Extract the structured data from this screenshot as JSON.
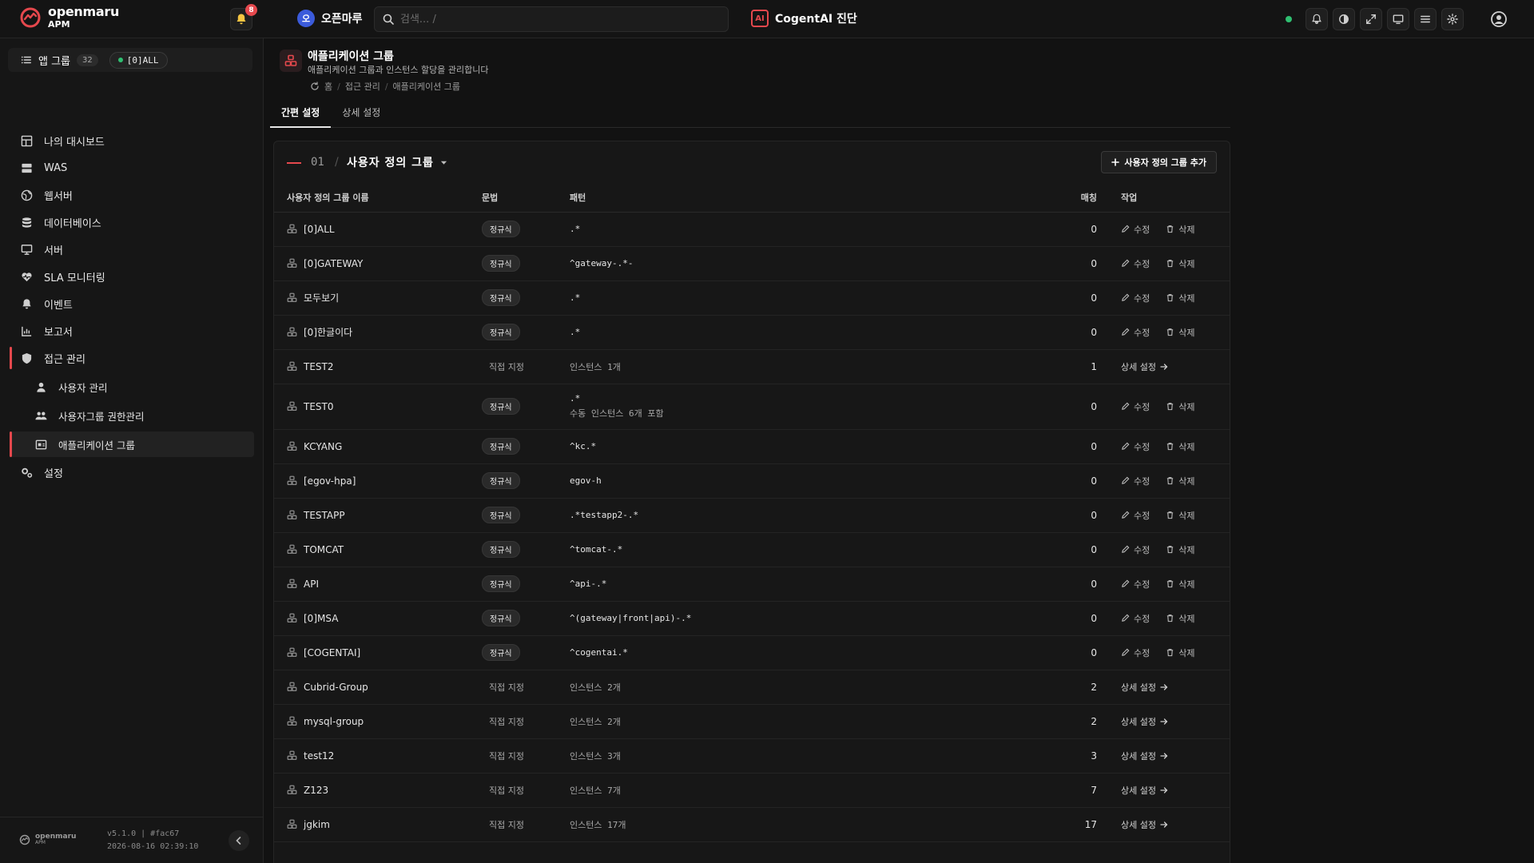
{
  "topbar": {
    "logo_name": "openmaru",
    "logo_sub": "APM",
    "notification_count": "8",
    "org_avatar": "오",
    "org_name": "오픈마루",
    "search_placeholder": "검색... /",
    "ai_mark": "AI",
    "ai_label": "CogentAI 진단",
    "status_color": "#2fbf71",
    "tool_icons": [
      "bell-icon",
      "contrast-icon",
      "expand-icon",
      "monitor-icon",
      "menu-icon",
      "gear-icon"
    ]
  },
  "sidebar": {
    "appgroup_label": "앱 그룹",
    "appgroup_count": "32",
    "selected_group": "[0]ALL",
    "items": [
      {
        "label": "나의 대시보드",
        "icon": "dashboard-icon"
      },
      {
        "label": "WAS",
        "icon": "server-stack-icon"
      },
      {
        "label": "웹서버",
        "icon": "globe-icon"
      },
      {
        "label": "데이터베이스",
        "icon": "database-icon"
      },
      {
        "label": "서버",
        "icon": "monitor-icon"
      },
      {
        "label": "SLA 모니터링",
        "icon": "heart-pulse-icon"
      },
      {
        "label": "이벤트",
        "icon": "bell-icon"
      },
      {
        "label": "보고서",
        "icon": "chart-icon"
      },
      {
        "label": "접근 관리",
        "icon": "shield-icon"
      },
      {
        "label": "사용자 관리",
        "icon": "user-icon"
      },
      {
        "label": "사용자그룹 권한관리",
        "icon": "users-icon"
      },
      {
        "label": "애플리케이션 그룹",
        "icon": "app-group-icon"
      },
      {
        "label": "설정",
        "icon": "gears-icon"
      }
    ],
    "footer_logo": "openmaru",
    "footer_logo_sub": "APM",
    "version": "v5.1.0 | #fac67",
    "build_time": "2026-08-16 02:39:10"
  },
  "page": {
    "title": "애플리케이션 그룹",
    "description": "애플리케이션 그룹과 인스턴스 할당을 관리합니다",
    "breadcrumb": [
      "홈",
      "접근 관리",
      "애플리케이션 그룹"
    ],
    "tabs": [
      "간편 설정",
      "상세 설정"
    ]
  },
  "panel": {
    "group_number": "01",
    "group_name": "사용자 정의 그룹",
    "add_button": "사용자 정의 그룹 추가",
    "columns": [
      "사용자 정의 그룹 이름",
      "문법",
      "패턴",
      "매칭",
      "작업"
    ],
    "edit_label": "수정",
    "delete_label": "삭제",
    "detail_label": "상세 설정",
    "rows": [
      {
        "name": "[0]ALL",
        "syntax": "정규식",
        "pattern": ".*",
        "sub": "",
        "match": "0"
      },
      {
        "name": "[0]GATEWAY",
        "syntax": "정규식",
        "pattern": "^gateway-.*-",
        "sub": "",
        "match": "0"
      },
      {
        "name": "모두보기",
        "syntax": "정규식",
        "pattern": ".*",
        "sub": "",
        "match": "0"
      },
      {
        "name": "[0]한글이다",
        "syntax": "정규식",
        "pattern": ".*",
        "sub": "",
        "match": "0"
      },
      {
        "name": "TEST2",
        "syntax": "직접 지정",
        "pattern": "인스턴스 1개",
        "sub": "",
        "match": "1"
      },
      {
        "name": "TEST0",
        "syntax": "정규식",
        "pattern": ".*",
        "sub": "수동 인스턴스 6개 포함",
        "match": "0"
      },
      {
        "name": "KCYANG",
        "syntax": "정규식",
        "pattern": "^kc.*",
        "sub": "",
        "match": "0"
      },
      {
        "name": "[egov-hpa]",
        "syntax": "정규식",
        "pattern": "egov-h",
        "sub": "",
        "match": "0"
      },
      {
        "name": "TESTAPP",
        "syntax": "정규식",
        "pattern": ".*testapp2-.*",
        "sub": "",
        "match": "0"
      },
      {
        "name": "TOMCAT",
        "syntax": "정규식",
        "pattern": "^tomcat-.*",
        "sub": "",
        "match": "0"
      },
      {
        "name": "API",
        "syntax": "정규식",
        "pattern": "^api-.*",
        "sub": "",
        "match": "0"
      },
      {
        "name": "[0]MSA",
        "syntax": "정규식",
        "pattern": "^(gateway|front|api)-.*",
        "sub": "",
        "match": "0"
      },
      {
        "name": "[COGENTAI]",
        "syntax": "정규식",
        "pattern": "^cogentai.*",
        "sub": "",
        "match": "0"
      },
      {
        "name": "Cubrid-Group",
        "syntax": "직접 지정",
        "pattern": "인스턴스 2개",
        "sub": "",
        "match": "2"
      },
      {
        "name": "mysql-group",
        "syntax": "직접 지정",
        "pattern": "인스턴스 2개",
        "sub": "",
        "match": "2"
      },
      {
        "name": "test12",
        "syntax": "직접 지정",
        "pattern": "인스턴스 3개",
        "sub": "",
        "match": "3"
      },
      {
        "name": "Z123",
        "syntax": "직접 지정",
        "pattern": "인스턴스 7개",
        "sub": "",
        "match": "7"
      },
      {
        "name": "jgkim",
        "syntax": "직접 지정",
        "pattern": "인스턴스 17개",
        "sub": "",
        "match": "17"
      }
    ]
  },
  "colors": {
    "accent": "#e5484d",
    "background": "#121212",
    "online": "#2fbf71"
  }
}
